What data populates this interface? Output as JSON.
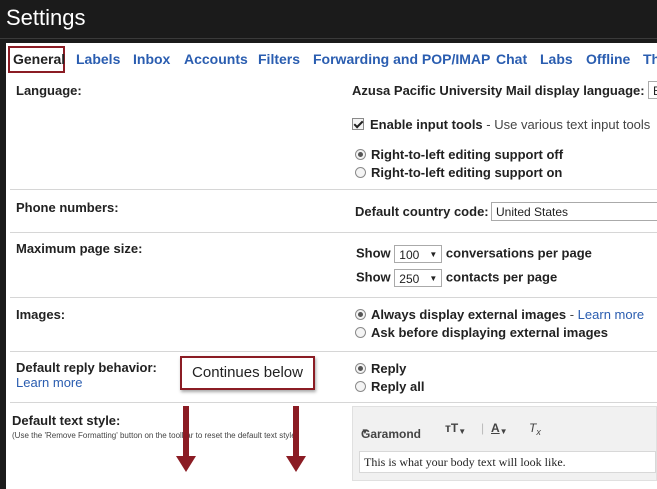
{
  "window": {
    "title": "Settings"
  },
  "tabs": [
    {
      "label": "General",
      "active": true
    },
    {
      "label": "Labels"
    },
    {
      "label": "Inbox"
    },
    {
      "label": "Accounts"
    },
    {
      "label": "Filters"
    },
    {
      "label": "Forwarding and POP/IMAP"
    },
    {
      "label": "Chat"
    },
    {
      "label": "Labs"
    },
    {
      "label": "Offline"
    },
    {
      "label": "Th"
    }
  ],
  "language": {
    "label": "Language:",
    "display_language_label": "Azusa Pacific University Mail display language:",
    "display_language_value": "E",
    "input_tools_label": "Enable input tools",
    "input_tools_desc": " - Use various text input tools",
    "input_tools_checked": true,
    "rtl_off": "Right-to-left editing support off",
    "rtl_on": "Right-to-left editing support on",
    "rtl_selected": "off"
  },
  "phone": {
    "label": "Phone numbers:",
    "country_code_label": "Default country code:",
    "country_code_value": "United States"
  },
  "page_size": {
    "label": "Maximum page size:",
    "show_label": "Show",
    "conversations_value": "100",
    "conversations_suffix": "conversations per page",
    "contacts_value": "250",
    "contacts_suffix": "contacts per page"
  },
  "images": {
    "label": "Images:",
    "always_label": "Always display external images",
    "always_dash": " - ",
    "learn_more": "Learn more",
    "ask_label": "Ask before displaying external images",
    "selected": "always"
  },
  "reply": {
    "label": "Default reply behavior:",
    "learn_more": "Learn more",
    "reply_label": "Reply",
    "reply_all_label": "Reply all",
    "selected": "reply"
  },
  "text_style": {
    "label": "Default text style:",
    "note": "(Use the 'Remove Formatting' button on the toolbar to reset the default text style)",
    "font_name": "Garamond",
    "preview_text": "This is what your body text will look like."
  },
  "callout": {
    "text": "Continues below"
  },
  "colors": {
    "accent_red": "#8b1c24",
    "link_blue": "#2a5db0",
    "title_bg": "#1b1b1b"
  }
}
